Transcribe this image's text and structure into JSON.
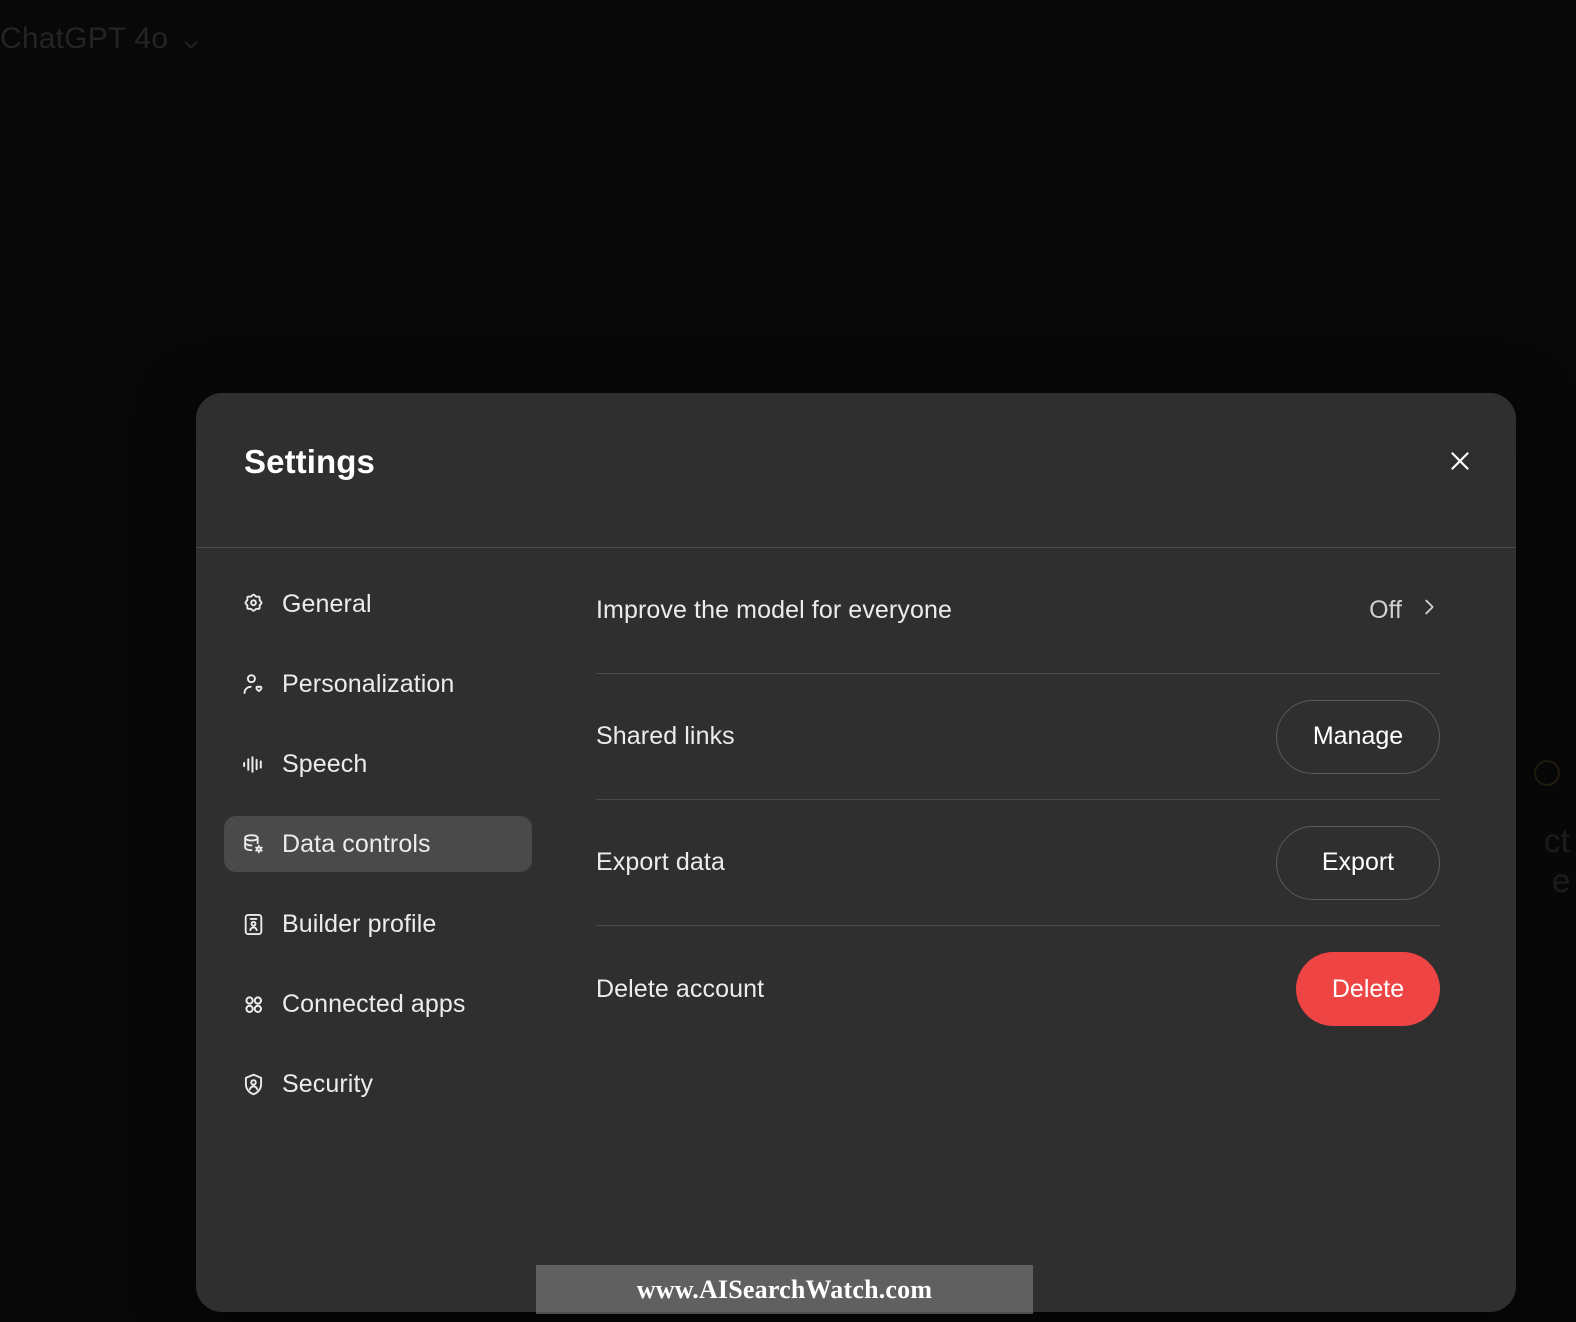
{
  "background": {
    "model_switcher_label": "ChatGPT 4o",
    "model_switcher_icon": "chevron-down-icon",
    "ghost_text_1": "ct",
    "ghost_text_2": "e"
  },
  "modal": {
    "title": "Settings",
    "close_icon": "close-icon"
  },
  "sidebar": {
    "items": [
      {
        "label": "General",
        "icon": "gear-icon",
        "active": false
      },
      {
        "label": "Personalization",
        "icon": "user-heart-icon",
        "active": false
      },
      {
        "label": "Speech",
        "icon": "waveform-icon",
        "active": false
      },
      {
        "label": "Data controls",
        "icon": "database-gear-icon",
        "active": true
      },
      {
        "label": "Builder profile",
        "icon": "id-card-icon",
        "active": false
      },
      {
        "label": "Connected apps",
        "icon": "grid-dots-icon",
        "active": false
      },
      {
        "label": "Security",
        "icon": "shield-user-icon",
        "active": false
      }
    ]
  },
  "content": {
    "rows": [
      {
        "label": "Improve the model for everyone",
        "control": "value",
        "value": "Off",
        "chevron_icon": "chevron-right-icon"
      },
      {
        "label": "Shared links",
        "control": "button",
        "button_label": "Manage",
        "button_style": "outline"
      },
      {
        "label": "Export data",
        "control": "button",
        "button_label": "Export",
        "button_style": "outline"
      },
      {
        "label": "Delete account",
        "control": "button",
        "button_label": "Delete",
        "button_style": "danger"
      }
    ]
  },
  "watermark": {
    "text": "www.AISearchWatch.com"
  },
  "colors": {
    "page_background": "#080808",
    "modal_background": "#2f2f2f",
    "divider": "#4a4a4a",
    "active_item": "#4a4a4a",
    "text_primary": "#ececec",
    "danger": "#ef4444"
  }
}
